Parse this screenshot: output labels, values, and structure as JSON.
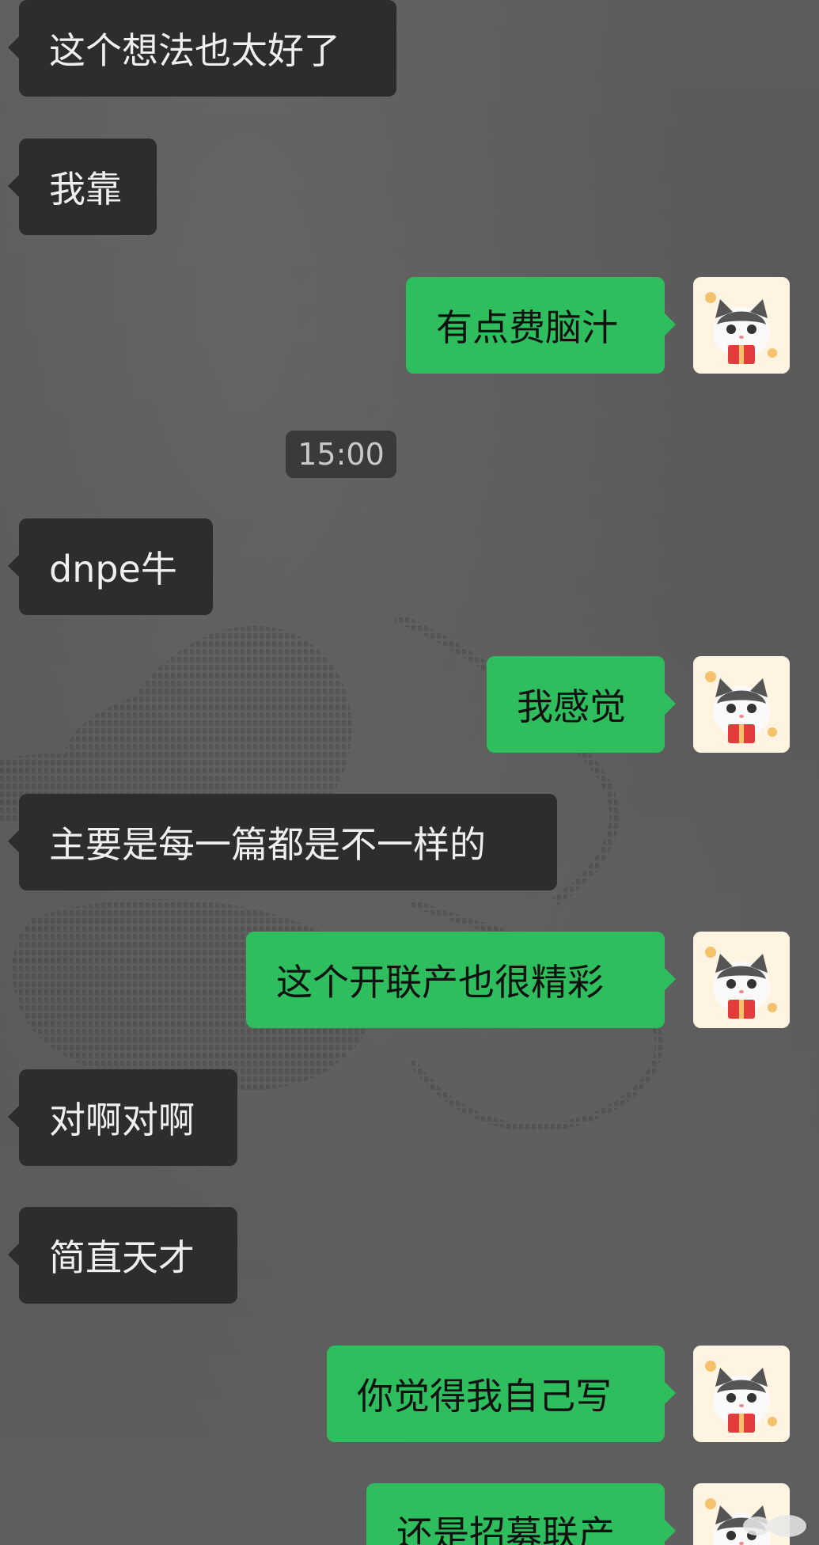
{
  "theme": {
    "background": "#5a5a5a",
    "incoming_bubble": "#2d2d2d",
    "outgoing_bubble": "#2fbe5e"
  },
  "messages": [
    {
      "side": "in",
      "text": "这个想法也太好了"
    },
    {
      "side": "in",
      "text": "我靠"
    },
    {
      "side": "out",
      "text": "有点费脑汁",
      "avatar": "cat-sticker-avatar"
    },
    {
      "type": "time",
      "text": "15:00"
    },
    {
      "side": "in",
      "text": "dnpe牛"
    },
    {
      "side": "out",
      "text": "我感觉",
      "avatar": "cat-sticker-avatar"
    },
    {
      "side": "in",
      "text": "主要是每一篇都是不一样的"
    },
    {
      "side": "out",
      "text": "这个开联产也很精彩",
      "avatar": "cat-sticker-avatar"
    },
    {
      "side": "in",
      "text": "对啊对啊"
    },
    {
      "side": "in",
      "text": "简直天才"
    },
    {
      "side": "out",
      "text": "你觉得我自己写",
      "avatar": "cat-sticker-avatar"
    },
    {
      "side": "out",
      "text": "还是招募联产",
      "avatar": "cat-sticker-avatar"
    }
  ]
}
